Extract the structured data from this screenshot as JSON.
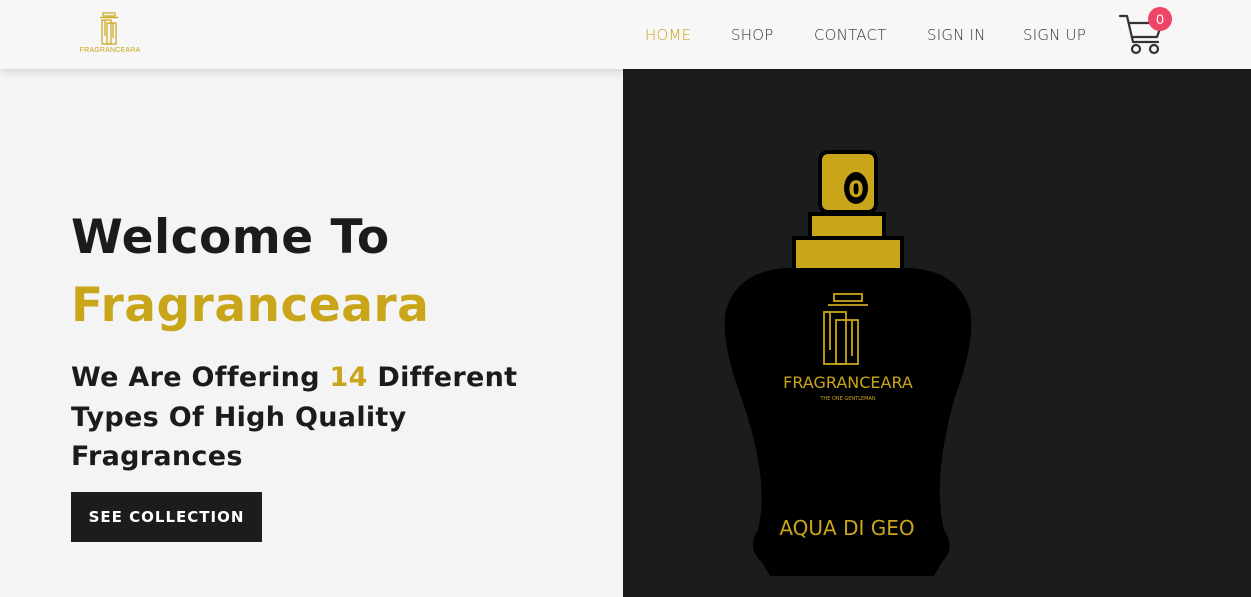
{
  "brand": {
    "logo_text": "FRAGRANCEARA",
    "bottle_brand": "FRAGRANCEARA",
    "bottle_tagline": "THE ONE GENTLEMAN",
    "bottle_cap_mark": "0",
    "bottle_name": "AQUA DI GEO"
  },
  "nav": {
    "items": [
      {
        "label": "HOME",
        "active": true
      },
      {
        "label": "SHOP",
        "active": false
      },
      {
        "label": "CONTACT",
        "active": false
      },
      {
        "label": "SIGN IN",
        "active": false
      },
      {
        "label": "SIGN UP",
        "active": false
      }
    ],
    "cart_count": "0"
  },
  "hero": {
    "title_line1": "Welcome To",
    "title_line2": "Fragranceara",
    "subtitle_before": "We Are Offering ",
    "subtitle_count": "14",
    "subtitle_after": " Different Types Of High Quality Fragrances",
    "cta_label": "SEE COLLECTION"
  },
  "colors": {
    "accent_gold": "#c9a51a",
    "dark": "#1b1c1e",
    "badge": "#ee4466",
    "background": "#f4f4f4"
  },
  "icons": [
    "logo-icon",
    "cart-icon",
    "bottle-logo-icon"
  ]
}
